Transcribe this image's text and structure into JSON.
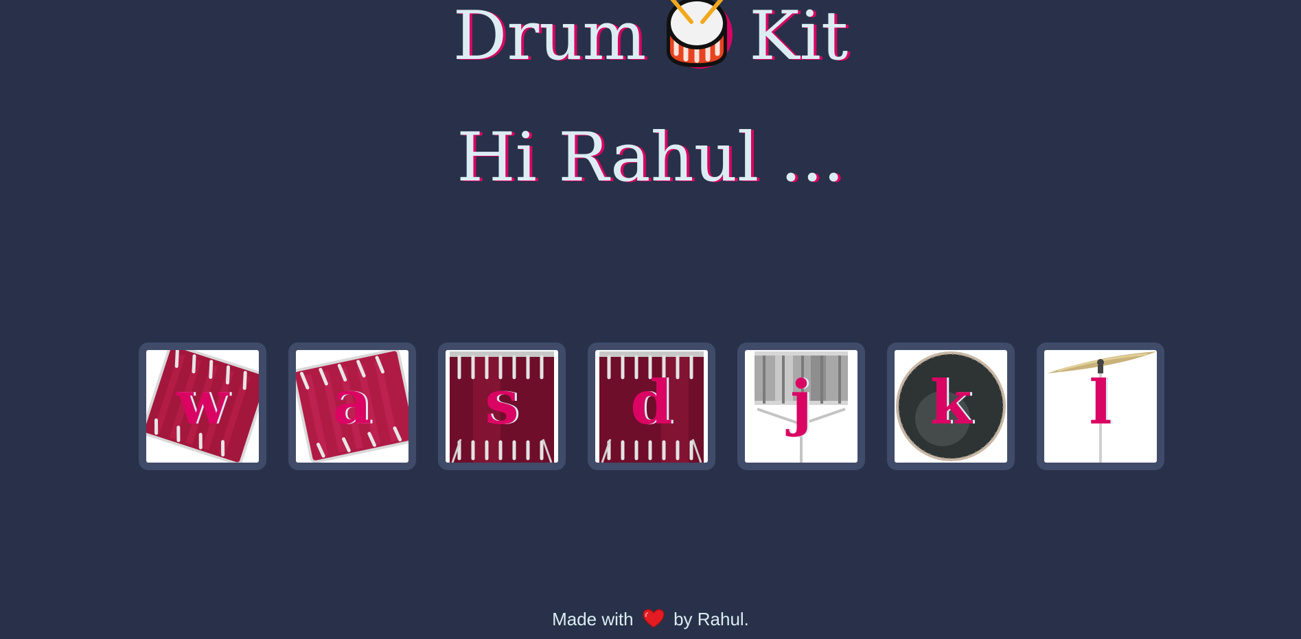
{
  "header": {
    "title_left": "Drum",
    "title_right": "Kit",
    "title_icon": "drum-emoji-icon",
    "greeting": "Hi Rahul ..."
  },
  "drums": [
    {
      "key": "w",
      "image": "tom-1-icon"
    },
    {
      "key": "a",
      "image": "tom-2-icon"
    },
    {
      "key": "s",
      "image": "tom-3-icon"
    },
    {
      "key": "d",
      "image": "tom-4-icon"
    },
    {
      "key": "j",
      "image": "snare-icon"
    },
    {
      "key": "k",
      "image": "kick-bass-icon"
    },
    {
      "key": "l",
      "image": "crash-cymbal-icon"
    }
  ],
  "footer": {
    "prefix": "Made with",
    "suffix": "by Rahul.",
    "icon": "heart-icon"
  },
  "colors": {
    "background": "#283149",
    "tile_border": "#404B69",
    "accent_pink": "#DA0463",
    "text_light": "#DBEDF3"
  }
}
